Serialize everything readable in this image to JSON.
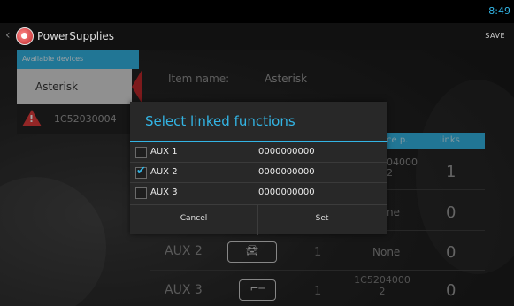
{
  "statusbar": {
    "time": "8:49"
  },
  "actionbar": {
    "title": "PowerSupplies",
    "save_label": "SAVE"
  },
  "devices": {
    "header": "Available devices",
    "selected": "Asterisk",
    "other": "1C52030004"
  },
  "item": {
    "label": "Item name:",
    "value": "Asterisk"
  },
  "table": {
    "header_device": "ce p.",
    "header_links": "links",
    "rows": [
      {
        "name": "",
        "count": "",
        "device": "04000\n2",
        "links": "1"
      },
      {
        "name": "",
        "count": "",
        "device": "ne",
        "links": "0"
      },
      {
        "name": "AUX 2",
        "icon": "car-icon",
        "count": "1",
        "device": "None",
        "links": "0"
      },
      {
        "name": "AUX 3",
        "icon": "flat-icon",
        "count": "1",
        "device": "1C5204000\n2",
        "links": "0"
      }
    ]
  },
  "dialog": {
    "title": "Select linked functions",
    "items": [
      {
        "label": "AUX 1",
        "value": "0000000000",
        "checked": false
      },
      {
        "label": "AUX 2",
        "value": "0000000000",
        "checked": true
      },
      {
        "label": "AUX 3",
        "value": "0000000000",
        "checked": false
      }
    ],
    "cancel_label": "Cancel",
    "set_label": "Set"
  },
  "colors": {
    "accent": "#33b5e5",
    "warning": "#e23b3b",
    "marker": "#c0282b"
  }
}
